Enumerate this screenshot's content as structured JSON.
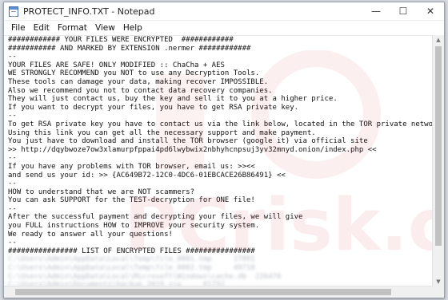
{
  "window": {
    "title": "PROTECT_INFO.TXT - Notepad",
    "minimize_glyph": "—",
    "maximize_glyph": "☐",
    "close_glyph": "✕"
  },
  "menu": [
    "File",
    "Edit",
    "Format",
    "View",
    "Help"
  ],
  "watermark_text": "PCrisk.com",
  "lines": [
    "############ YOUR FILES WERE ENCRYPTED  ############",
    "########### AND MARKED BY EXTENSION .nermer ############",
    "--",
    "YOUR FILES ARE SAFE! ONLY MODIFIED :: ChaCha + AES",
    "WE STRONGLY RECOMMEND you NOT to use any Decryption Tools.",
    "These tools can damage your data, making recover IMPOSSIBLE.",
    "Also we recommend you not to contact data recovery companies.",
    "They will just contact us, buy the key and sell it to you at a higher price.",
    "If you want to decrypt your files, you have to get RSA private key.",
    "--",
    "To get RSA private key you have to contact us via the link below, located in the TOR private network.",
    "Using this link you can get all the necessary support and make payment.",
    "You just have to download and install the TOR browser (google it) via official site",
    ">> http://dqybwoze7ow3xlamurpfppai4pd6lwybwix2nbhyhcnpsuj3yv32mnyd.onion/index.php <<",
    "--",
    "If you have any problems with TOR browser, email us: >><<",
    "and send us your id: >> {AC649B72-12C0-4DC6-01EBCACE26B86491} <<",
    "--",
    "HOW to understand that we are NOT scammers?",
    "You can ask SUPPORT for the TEST-decryption for ONE file!",
    "--",
    "After the successful payment and decrypting your files, we will give",
    "you FULL instructions HOW to IMPROVE your security system.",
    "We ready to answer all your questions!",
    "--",
    "################ LIST OF ENCRYPTED FILES ################"
  ],
  "blurred_lines": [
    "C:\\Users\\Admin\\AppData\\Local\\Temp\\file_0001.tmp     17891",
    "C:\\Users\\Admin\\AppData\\Local\\Temp\\file_0002.tmp     49718",
    "C:\\Users\\Admin\\AppData\\Local\\Microsoft\\Windows\\cache.db  226470",
    "C:\\Users\\Admin\\Documents\\backup_2019.zip     81752",
    "C:\\Users\\Admin\\Desktop\\report_final.docx     4817"
  ]
}
